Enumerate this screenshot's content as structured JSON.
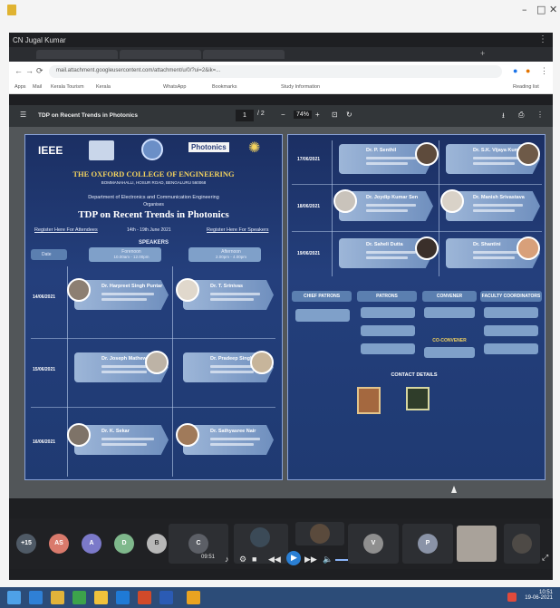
{
  "window": {
    "minimize": "–",
    "maximize": "□",
    "close": "✕"
  },
  "meeting": {
    "title": "CN Jugal Kumar"
  },
  "browser": {
    "tabs": [
      "",
      "",
      ""
    ],
    "url": "mail.attachment.googleusercontent.com/attachment/u/0/?ui=2&ik=...",
    "bookmarks": [
      "Apps",
      "Mail",
      "Kerala Tourism",
      "Kerala",
      "WhatsApp",
      "Bookmarks",
      "Study Information"
    ],
    "reading_list": "Reading list"
  },
  "pdf": {
    "title": "TDP on Recent Trends in Photonics",
    "page_current": "1",
    "page_total": "/ 2",
    "zoom": "74%"
  },
  "poster_left": {
    "logos": [
      "IEEE",
      "Photonics"
    ],
    "college": "THE OXFORD COLLEGE OF ENGINEERING",
    "college_sub": "BOMMANAHALLI, HOSUR ROAD, BENGALURU 560068",
    "dept": "Department of Electronics and Communication Engineering",
    "organising": "Organises",
    "tdp_title": "TDP on Recent Trends in Photonics",
    "dates_label": "14th - 19th June 2021",
    "left_link": "Register Here For Attendees",
    "right_link": "Register Here For Speakers",
    "speakers_head": "SPEAKERS",
    "session1": "Forenoon",
    "session1_time": "10.00am - 12.00pm",
    "session2": "Afternoon",
    "session2_time": "2.00pm - 4.00pm",
    "date_col": "Date",
    "rows": [
      {
        "date": "14/06/2021",
        "a": "Dr. Harpreet Singh Puntar",
        "b": "Dr. T. Srinivas"
      },
      {
        "date": "15/06/2021",
        "a": "Dr. Joseph Mathew",
        "b": "Dr. Pradeep Singh"
      },
      {
        "date": "16/06/2021",
        "a": "Dr. K. Sekar",
        "b": "Dr. Sathyasree Nair"
      }
    ]
  },
  "poster_right": {
    "rows": [
      {
        "date": "17/06/2021",
        "a": "Dr. P. Senthil",
        "b": "Dr. S.K. Vijaya Kumar"
      },
      {
        "date": "18/06/2021",
        "a": "Dr. Joydip Kumar Sen",
        "b": "Dr. Manish Srivastava"
      },
      {
        "date": "19/06/2021",
        "a": "Dr. Saheli Dutta",
        "b": "Dr. Shantini"
      }
    ],
    "comm_heads": [
      "CHIEF PATRONS",
      "PATRONS",
      "CONVENER",
      "FACULTY COORDINATORS"
    ],
    "coconvener": "CO-CONVENER",
    "contact": "CONTACT DETAILS"
  },
  "participants": [
    {
      "initials": "+15",
      "color": "#4f5a66"
    },
    {
      "initials": "AS",
      "color": "#d97a6c"
    },
    {
      "initials": "A",
      "color": "#7b79c9"
    },
    {
      "initials": "D",
      "color": "#7fb88c"
    },
    {
      "initials": "B",
      "color": "#b7b7b7"
    },
    {
      "initials": "C",
      "color": "#5c5f66"
    },
    {
      "initials": "V",
      "color": "#8f8f8f"
    },
    {
      "initials": "P",
      "color": "#8a93a7"
    }
  ],
  "player": {
    "time": "09:51"
  },
  "taskbar": {
    "time": "10:51",
    "date": "19-06-2021"
  },
  "colors": {
    "poster_bg": "#1f3a72",
    "accent_yellow": "#f4d35e",
    "taskbar": "#2c4c78"
  }
}
